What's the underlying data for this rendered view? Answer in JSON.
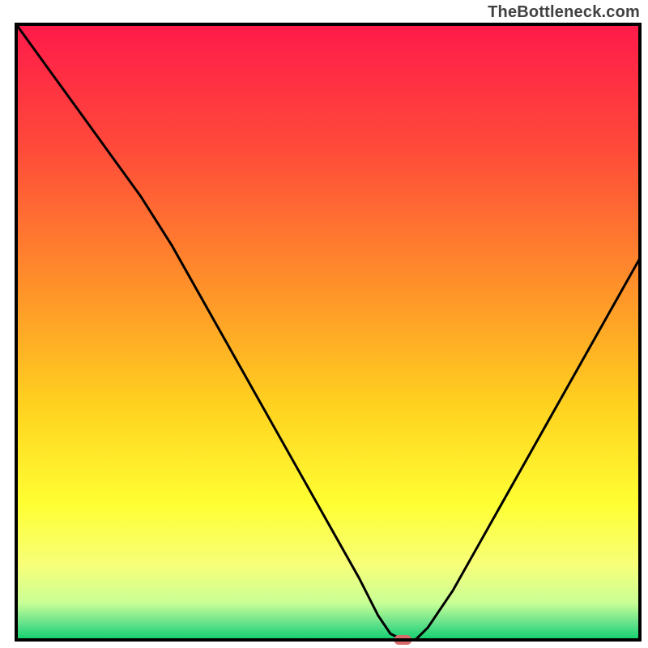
{
  "watermark": "TheBottleneck.com",
  "chart_data": {
    "type": "line",
    "title": "",
    "xlabel": "",
    "ylabel": "",
    "xlim": [
      0,
      100
    ],
    "ylim": [
      0,
      100
    ],
    "grid": false,
    "curve_description": "V-shaped bottleneck curve; minimum near x≈62 at y≈0",
    "x": [
      0,
      5,
      10,
      15,
      20,
      25,
      30,
      35,
      40,
      45,
      50,
      55,
      58,
      60,
      62,
      64,
      66,
      70,
      75,
      80,
      85,
      90,
      95,
      100
    ],
    "values": [
      100,
      93,
      86,
      79,
      72,
      64,
      55,
      46,
      37,
      28,
      19,
      10,
      4,
      1,
      0,
      0,
      2,
      8,
      17,
      26,
      35,
      44,
      53,
      62
    ],
    "marker": {
      "x": 62,
      "y": 0,
      "color": "#d96b6b"
    },
    "background_gradient": {
      "type": "vertical",
      "stops": [
        {
          "pos": 0.0,
          "color": "#ff1a4a"
        },
        {
          "pos": 0.2,
          "color": "#ff4a3a"
        },
        {
          "pos": 0.42,
          "color": "#ff8f2a"
        },
        {
          "pos": 0.62,
          "color": "#ffd21f"
        },
        {
          "pos": 0.78,
          "color": "#ffff33"
        },
        {
          "pos": 0.88,
          "color": "#f7ff7a"
        },
        {
          "pos": 0.94,
          "color": "#c9ff96"
        },
        {
          "pos": 0.975,
          "color": "#5fe08a"
        },
        {
          "pos": 1.0,
          "color": "#0ecf6e"
        }
      ]
    },
    "frame_color": "#000000",
    "curve_color": "#000000"
  }
}
